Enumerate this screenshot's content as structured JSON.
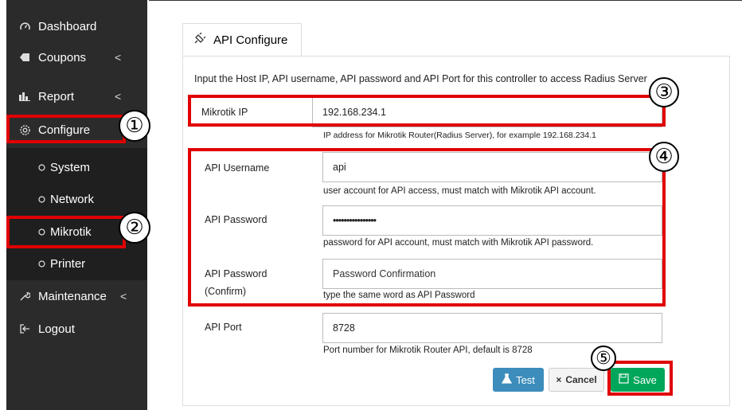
{
  "sidebar": {
    "items": [
      {
        "label": "Dashboard",
        "icon": "gauge-icon"
      },
      {
        "label": "Coupons",
        "icon": "tag-icon"
      },
      {
        "label": "Report",
        "icon": "bar-chart-icon"
      },
      {
        "label": "Configure",
        "icon": "gear-icon"
      },
      {
        "label": "System",
        "icon": "circle-icon"
      },
      {
        "label": "Network",
        "icon": "circle-icon"
      },
      {
        "label": "Mikrotik",
        "icon": "circle-icon"
      },
      {
        "label": "Printer",
        "icon": "circle-icon"
      },
      {
        "label": "Maintenance",
        "icon": "wrench-icon"
      },
      {
        "label": "Logout",
        "icon": "logout-icon"
      }
    ],
    "chevron": "<"
  },
  "tab": {
    "label": "API Configure"
  },
  "intro": "Input the Host IP, API username, API password and API Port for this controller to access Radius Server",
  "form": {
    "mikrotik_ip": {
      "label": "Mikrotik IP",
      "value": "192.168.234.1",
      "hint": "IP address for Mikrotik Router(Radius Server), for example 192.168.234.1"
    },
    "api_username": {
      "label": "API Username",
      "value": "api",
      "hint": "user account for API access, must match with Mikrotik API account."
    },
    "api_password": {
      "label": "API Password",
      "value": "••••••••••••••••",
      "hint": "password for API account, must match with Mikrotik API password."
    },
    "api_password_confirm": {
      "label1": "API Password",
      "label2": "(Confirm)",
      "placeholder": "Password Confirmation",
      "hint": "type the same word as API Password"
    },
    "api_port": {
      "label": "API Port",
      "value": "8728",
      "hint": "Port number for Mikrotik Router API, default is 8728"
    }
  },
  "buttons": {
    "test": "Test",
    "cancel": "Cancel",
    "save": "Save"
  },
  "annotations": [
    "①",
    "②",
    "③",
    "④",
    "⑤"
  ],
  "colors": {
    "sidebar_bg": "#2b2b2b",
    "highlight": "#e00000",
    "test_btn": "#3c8dbc",
    "save_btn": "#00a65a"
  }
}
